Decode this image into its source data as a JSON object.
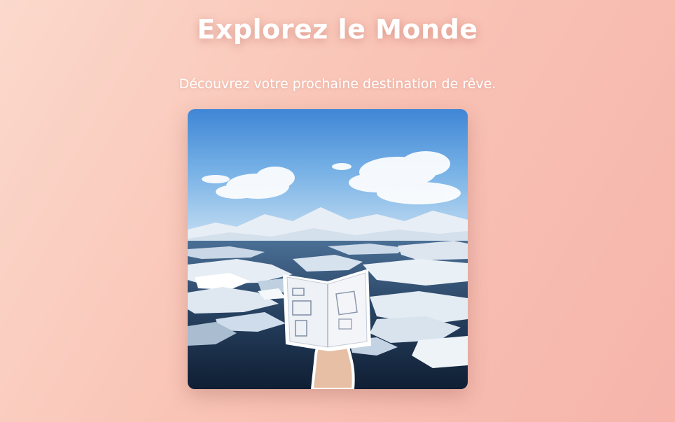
{
  "hero": {
    "title": "Explorez le Monde",
    "subtitle": "Découvrez votre prochaine destination de rêve.",
    "image_icon": "passport-glacier-photo"
  },
  "colors": {
    "background_start": "#fbd9cc",
    "background_end": "#f6b4ab",
    "text": "#ffffff"
  }
}
